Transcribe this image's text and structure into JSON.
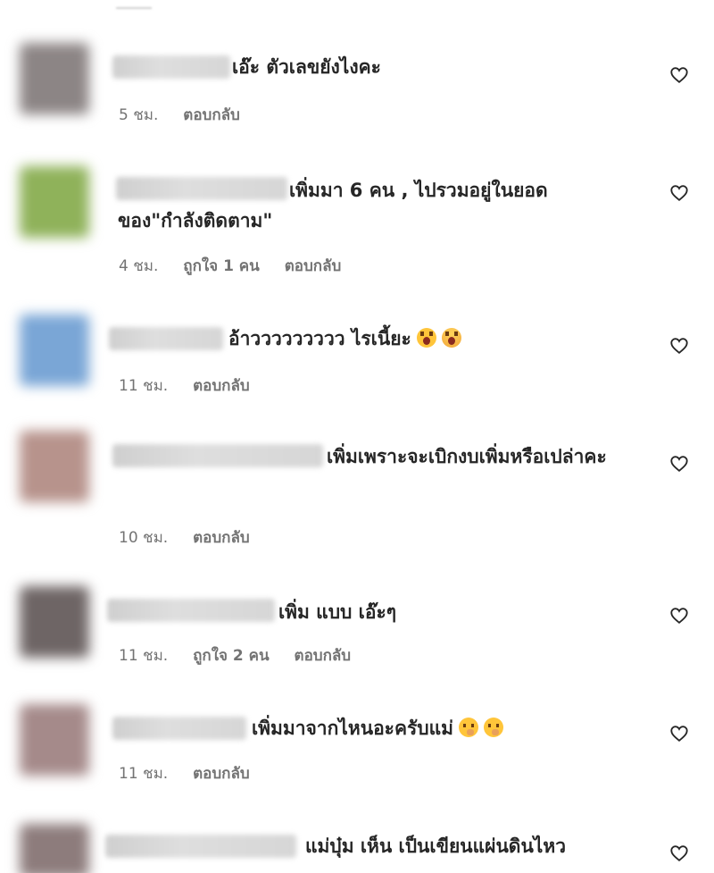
{
  "comments": [
    {
      "text": "เอ๊ะ ตัวเลขยังไงคะ",
      "time": "5 ชม.",
      "likes": "",
      "reply": "ตอบกลับ",
      "avatar_color": "#8c8585",
      "emojis": []
    },
    {
      "text": "เพิ่มมา 6 คน , ไปรวมอยู่ในยอดของ\"กำลังติดตาม\"",
      "time": "4 ชม.",
      "likes": "ถูกใจ 1 คน",
      "reply": "ตอบกลับ",
      "avatar_color": "#8fb25a",
      "emojis": []
    },
    {
      "text": "อ้าววววววววว ไรเนี้ยะ",
      "time": "11 ชม.",
      "likes": "",
      "reply": "ตอบกลับ",
      "avatar_color": "#7aa6d6",
      "emojis": [
        "scream-emoji",
        "scream-emoji"
      ]
    },
    {
      "text": "เพิ่มเพราะจะเบิกงบเพิ่มหรือเปล่าคะ",
      "time": "10 ชม.",
      "likes": "",
      "reply": "ตอบกลับ",
      "avatar_color": "#b7938c",
      "emojis": []
    },
    {
      "text": "เพิ่ม แบบ เอ๊ะๆ",
      "time": "11 ชม.",
      "likes": "ถูกใจ 2 คน",
      "reply": "ตอบกลับ",
      "avatar_color": "#6e6565",
      "emojis": []
    },
    {
      "text": "เพิ่มมาจากไหนอะครับแม่",
      "time": "11 ชม.",
      "likes": "",
      "reply": "ตอบกลับ",
      "avatar_color": "#a58a8a",
      "emojis": [
        "thinking-emoji",
        "thinking-emoji"
      ]
    },
    {
      "text": "แม่บุ๋ม เห็น เป็นเขียนแผ่นดินไหว",
      "time": "",
      "likes": "",
      "reply": "",
      "avatar_color": "#8d7c7c",
      "emojis": []
    }
  ],
  "icons": {
    "like": "heart-outline-icon"
  }
}
